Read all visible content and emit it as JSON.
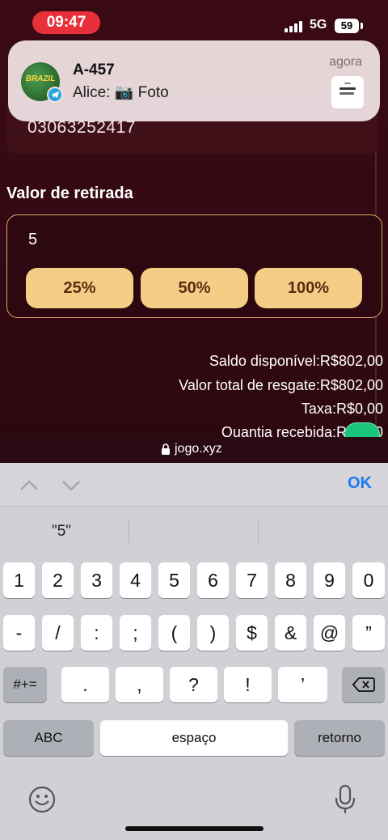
{
  "status_bar": {
    "time": "09:47",
    "network": "5G",
    "battery": "59"
  },
  "notification": {
    "avatar_text": "BRAZIL",
    "title": "A-457",
    "body": "Alice: 📷 Foto",
    "time": "agora"
  },
  "account": {
    "number": "03063252417"
  },
  "withdraw": {
    "title": "Valor de retirada",
    "amount_value": "5",
    "buttons": [
      "25%",
      "50%",
      "100%"
    ]
  },
  "summary": {
    "available": "Saldo disponível:R$802,00",
    "total": "Valor total de resgate:R$802,00",
    "fee": "Taxa:R$0,00",
    "received": "Quantia recebida:R$5,00"
  },
  "browser": {
    "url": "jogo.xyz"
  },
  "keyboard": {
    "done_label": "OK",
    "suggestion": "\"5\"",
    "row1": [
      "1",
      "2",
      "3",
      "4",
      "5",
      "6",
      "7",
      "8",
      "9",
      "0"
    ],
    "row2": [
      "-",
      "/",
      ":",
      ";",
      "(",
      ")",
      "$",
      "&",
      "@",
      "”"
    ],
    "row3_symbols": "#+=",
    "row3": [
      ".",
      ",",
      "?",
      "!",
      "’"
    ],
    "abc": "ABC",
    "space": "espaço",
    "return": "retorno"
  }
}
